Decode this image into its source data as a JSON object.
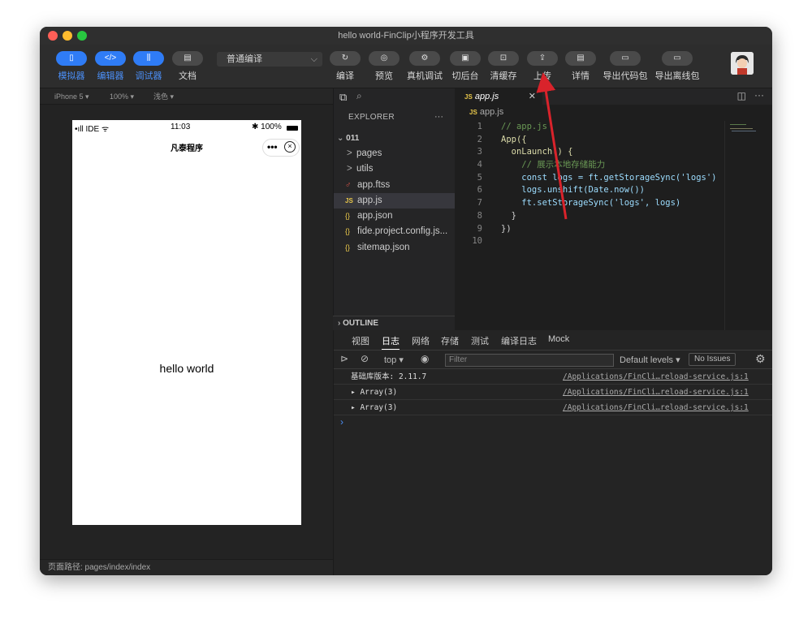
{
  "window": {
    "title": "hello world-FinClip小程序开发工具"
  },
  "toolbar": {
    "left_buttons": [
      {
        "label": "模拟器",
        "icon": "phone-icon"
      },
      {
        "label": "编辑器",
        "icon": "code-icon"
      },
      {
        "label": "调试器",
        "icon": "debug-icon"
      },
      {
        "label": "文档",
        "icon": "doc-icon"
      }
    ],
    "compile_mode": "普通编译",
    "actions": [
      {
        "label": "编译",
        "icon": "refresh-icon"
      },
      {
        "label": "预览",
        "icon": "eye-icon"
      },
      {
        "label": "真机调试",
        "icon": "device-icon"
      },
      {
        "label": "切后台",
        "icon": "background-icon"
      },
      {
        "label": "清缓存",
        "icon": "clear-icon"
      },
      {
        "label": "上传",
        "icon": "upload-icon"
      },
      {
        "label": "详情",
        "icon": "details-icon"
      },
      {
        "label": "导出代码包",
        "icon": "folder-icon"
      },
      {
        "label": "导出离线包",
        "icon": "folder-icon"
      }
    ]
  },
  "simulator": {
    "device": "iPhone 5 ▾",
    "zoom": "100% ▾",
    "theme": "浅色 ▾",
    "status_left": "•ıll IDE ᯤ",
    "status_time": "11:03",
    "status_right": "✱ 100%",
    "nav_title": "凡泰程序",
    "content_text": "hello world",
    "path_label": "页面路径: pages/index/index"
  },
  "explorer": {
    "title": "EXPLORER",
    "more": "···",
    "project": "011",
    "items": [
      {
        "label": "pages",
        "prefix": ">"
      },
      {
        "label": "utils",
        "prefix": ">"
      },
      {
        "label": "app.ftss",
        "prefix": "♂"
      },
      {
        "label": "app.js",
        "prefix": "JS"
      },
      {
        "label": "app.json",
        "prefix": "{}"
      },
      {
        "label": "fide.project.config.js...",
        "prefix": "{}"
      },
      {
        "label": "sitemap.json",
        "prefix": "{}"
      }
    ],
    "outline": "OUTLINE"
  },
  "editor": {
    "tab": "app.js",
    "tab_prefix": "JS",
    "breadcrumb": "app.js",
    "lines": [
      {
        "n": "1",
        "text": "// app.js"
      },
      {
        "n": "2",
        "text": "App({"
      },
      {
        "n": "3",
        "text": "  onLaunch() {"
      },
      {
        "n": "4",
        "text": "    // 展示本地存储能力"
      },
      {
        "n": "5",
        "text": "    const logs = ft.getStorageSync('logs')"
      },
      {
        "n": "6",
        "text": "    logs.unshift(Date.now())"
      },
      {
        "n": "7",
        "text": "    ft.setStorageSync('logs', logs)"
      },
      {
        "n": "8",
        "text": "  }"
      },
      {
        "n": "9",
        "text": "})"
      },
      {
        "n": "10",
        "text": ""
      }
    ]
  },
  "console": {
    "tabs": [
      "视图",
      "日志",
      "网络",
      "存储",
      "测试",
      "编译日志",
      "Mock"
    ],
    "active_tab": "日志",
    "context": "top ▾",
    "filter_placeholder": "Filter",
    "levels": "Default levels ▾",
    "issues": "No Issues",
    "logs": [
      {
        "text": "基础库版本: 2.11.7",
        "source": "/Applications/FinCli…reload-service.js:1"
      },
      {
        "text": "▸ Array(3)",
        "source": "/Applications/FinCli…reload-service.js:1"
      },
      {
        "text": "▸ Array(3)",
        "source": "/Applications/FinCli…reload-service.js:1"
      }
    ],
    "prompt": "›"
  },
  "colors": {
    "accent": "#2f7cf6",
    "annotation_arrow": "#d9232b"
  }
}
